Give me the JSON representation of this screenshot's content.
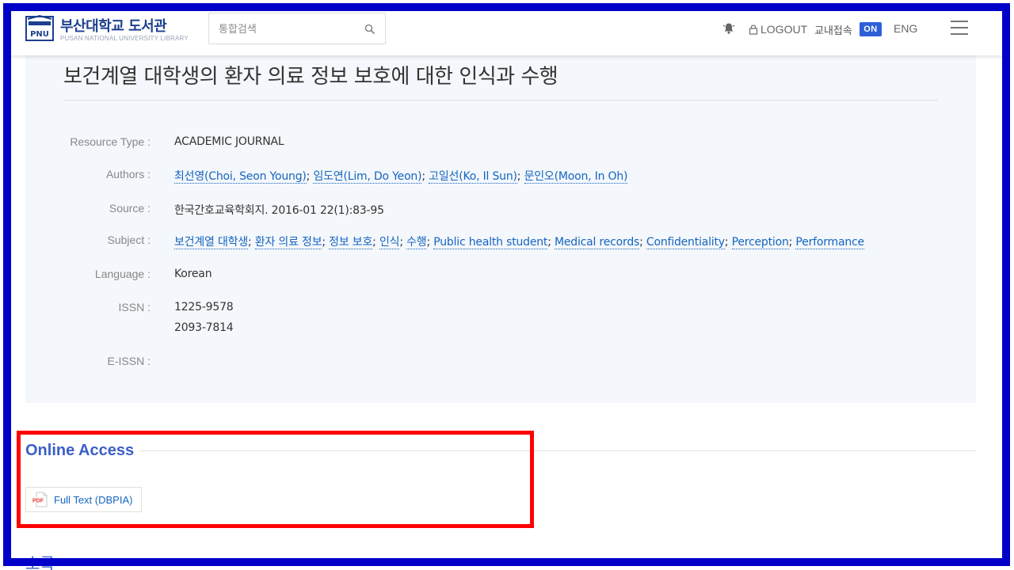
{
  "header": {
    "logo_title": "부산대학교 도서관",
    "logo_subtitle": "PUSAN NATIONAL UNIVERSITY LIBRARY",
    "search_placeholder": "통합검색",
    "logout_label": "LOGOUT",
    "campus_label": "교내접속",
    "campus_status": "ON",
    "language_label": "ENG"
  },
  "record": {
    "title": "보건계열 대학생의 환자 의료 정보 보호에 대한 인식과 수행",
    "fields": {
      "resource_type": {
        "label": "Resource Type :",
        "value": "ACADEMIC JOURNAL"
      },
      "authors": {
        "label": "Authors :",
        "items": [
          "최선영(Choi, Seon Young)",
          "임도연(Lim, Do Yeon)",
          "고일선(Ko, Il Sun)",
          "문인오(Moon, In Oh)"
        ]
      },
      "source": {
        "label": "Source :",
        "value": "한국간호교육학회지. 2016-01 22(1):83-95"
      },
      "subject": {
        "label": "Subject :",
        "items": [
          "보건계열 대학생",
          "환자 의료 정보",
          "정보 보호",
          "인식",
          "수행",
          "Public health student",
          "Medical records",
          "Confidentiality",
          "Perception",
          "Performance"
        ]
      },
      "language": {
        "label": "Language :",
        "value": "Korean"
      },
      "issn": {
        "label": "ISSN :",
        "values": [
          "1225-9578",
          "2093-7814"
        ]
      },
      "eissn": {
        "label": "E-ISSN :",
        "value": ""
      }
    }
  },
  "online_access": {
    "title": "Online Access",
    "fulltext_label": "Full Text (DBPIA)"
  },
  "next_section": {
    "title": "초록"
  },
  "colors": {
    "accent": "#3a5fc7",
    "link": "#1565c0",
    "badge": "#2e5fd8",
    "frame": "#0000c8",
    "highlight": "#ff0000"
  }
}
